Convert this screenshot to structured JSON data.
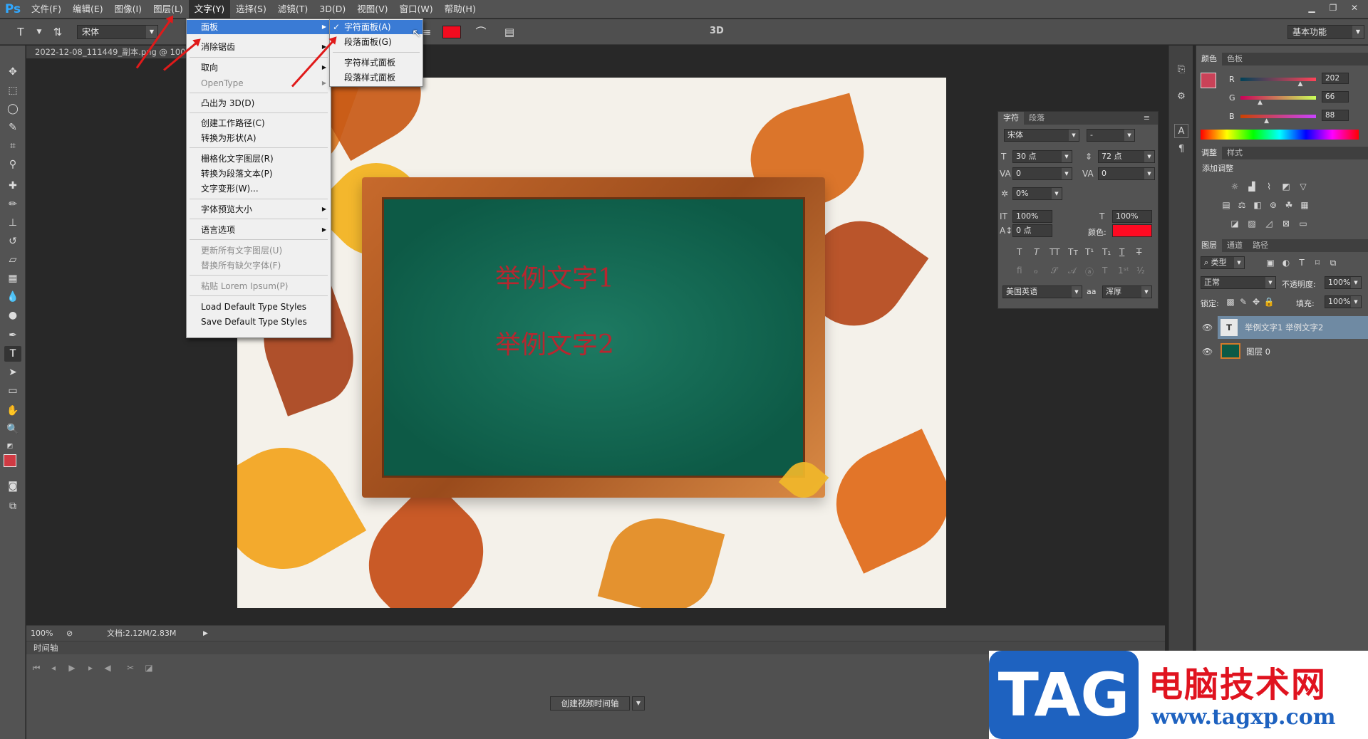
{
  "menubar": {
    "logo": "Ps",
    "items": [
      "文件(F)",
      "编辑(E)",
      "图像(I)",
      "图层(L)",
      "文字(Y)",
      "选择(S)",
      "滤镜(T)",
      "3D(D)",
      "视图(V)",
      "窗口(W)",
      "帮助(H)"
    ],
    "active_index": 4
  },
  "options": {
    "font": "宋体",
    "label_3d": "3D",
    "workspace": "基本功能"
  },
  "document": {
    "tab": "2022-12-08_111449_副本.png @ 100%",
    "zoom": "100%",
    "doc_size": "文档:2.12M/2.83M"
  },
  "canvas": {
    "text1": "举例文字1",
    "text2": "举例文字2"
  },
  "type_menu": [
    {
      "label": "面板",
      "submenu": true,
      "highlight": true
    },
    {
      "label": "消除锯齿",
      "submenu": true
    },
    {
      "label": "取向",
      "submenu": true
    },
    {
      "label": "OpenType",
      "submenu": true,
      "disabled": true
    },
    {
      "label": "凸出为 3D(D)"
    },
    {
      "label": "创建工作路径(C)"
    },
    {
      "label": "转换为形状(A)"
    },
    {
      "label": "栅格化文字图层(R)"
    },
    {
      "label": "转换为段落文本(P)"
    },
    {
      "label": "文字变形(W)..."
    },
    {
      "label": "字体预览大小",
      "submenu": true
    },
    {
      "label": "语言选项",
      "submenu": true
    },
    {
      "label": "更新所有文字图层(U)",
      "disabled": true
    },
    {
      "label": "替换所有缺欠字体(F)",
      "disabled": true
    },
    {
      "label": "粘贴 Lorem Ipsum(P)",
      "disabled": true
    },
    {
      "label": "Load Default Type Styles"
    },
    {
      "label": "Save Default Type Styles"
    }
  ],
  "panel_submenu": [
    {
      "label": "字符面板(A)",
      "checked": true,
      "highlight": true
    },
    {
      "label": "段落面板(G)"
    },
    {
      "label": "字符样式面板"
    },
    {
      "label": "段落样式面板"
    }
  ],
  "character_panel": {
    "tabs": [
      "字符",
      "段落"
    ],
    "font": "宋体",
    "style": "-",
    "size": "30 点",
    "leading": "72 点",
    "kerning": "0",
    "tracking": "0",
    "scale_pct": "0%",
    "vscale": "100%",
    "hscale": "100%",
    "baseline": "0 点",
    "color_label": "颜色:",
    "color": "#ff0a22",
    "language": "美国英语",
    "antialias": "浑厚",
    "aa_label": "aa"
  },
  "color_panel": {
    "tabs": [
      "颜色",
      "色板"
    ],
    "r_label": "R",
    "g_label": "G",
    "b_label": "B",
    "r": "202",
    "g": "66",
    "b": "88",
    "r_level": 202,
    "g_level": 66,
    "b_level": 88,
    "fg": "#ca4258"
  },
  "adjust_panel": {
    "tabs": [
      "调整",
      "样式"
    ],
    "title": "添加调整"
  },
  "layers_panel": {
    "tabs": [
      "图层",
      "通道",
      "路径"
    ],
    "filter": "类型",
    "blend": "正常",
    "opacity_label": "不透明度:",
    "opacity": "100%",
    "lock_label": "锁定:",
    "fill_label": "填充:",
    "fill": "100%",
    "layers": [
      {
        "name": "举例文字1 举例文字2",
        "type": "text",
        "selected": true
      },
      {
        "name": "图层 0",
        "type": "image",
        "selected": false
      }
    ]
  },
  "timeline": {
    "title": "时间轴",
    "create_btn": "创建视频时间轴"
  },
  "watermark": {
    "tag": "TAG",
    "title": "电脑技术网",
    "url": "www.tagxp.com"
  },
  "colors": {
    "accent": "#31a8ff",
    "menu_highlight": "#3a7bd5",
    "text_red": "#b8262f",
    "swatch_red": "#f20b1f"
  }
}
